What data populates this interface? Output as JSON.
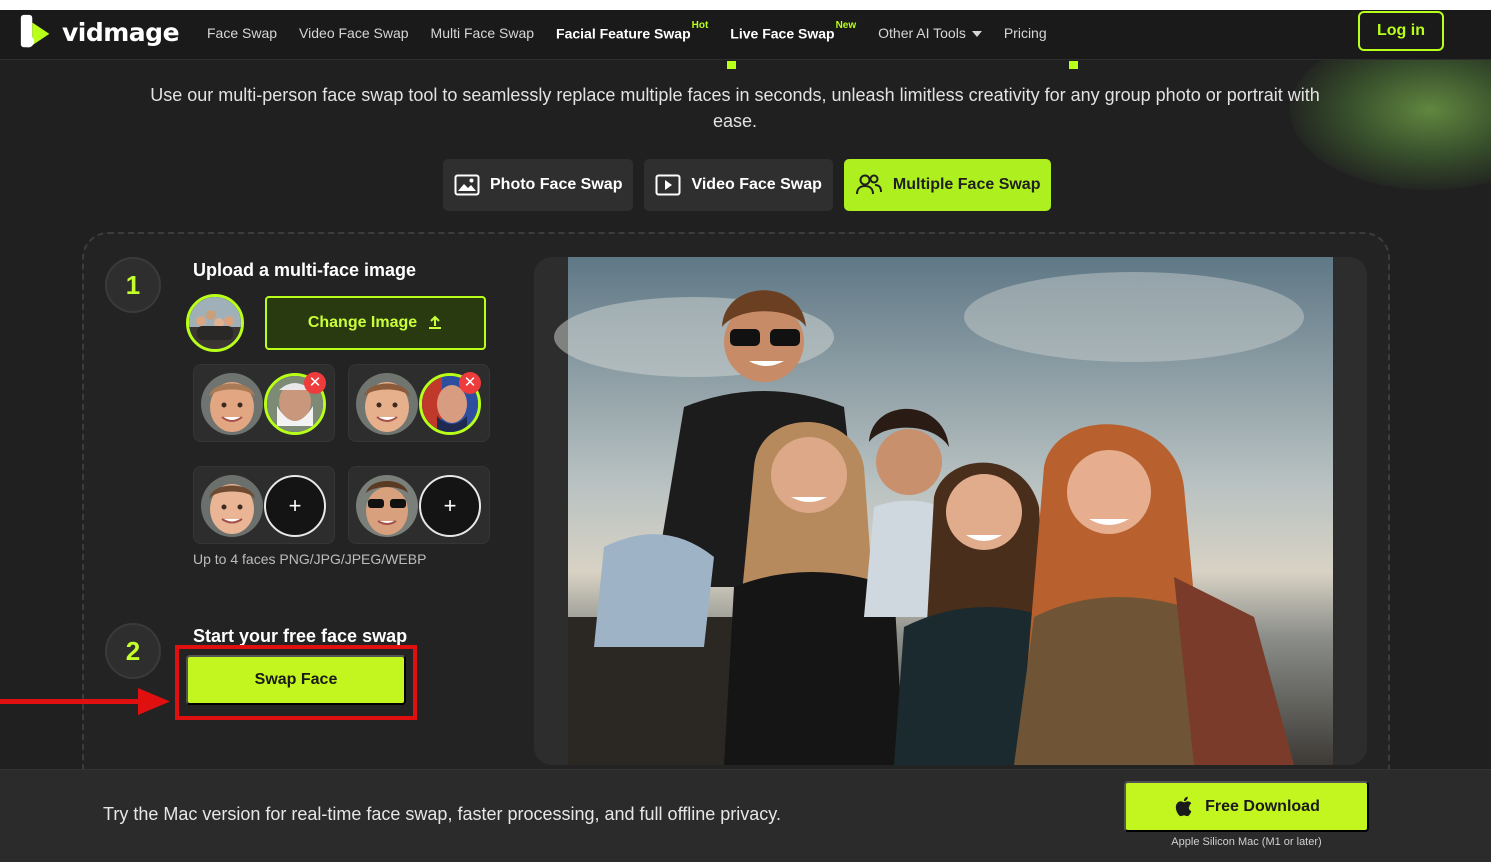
{
  "brand": {
    "name": "vidmage"
  },
  "nav": {
    "items": [
      {
        "label": "Face Swap",
        "bold": false
      },
      {
        "label": "Video Face Swap",
        "bold": false
      },
      {
        "label": "Multi Face Swap",
        "bold": false
      },
      {
        "label": "Facial Feature Swap",
        "badge": "Hot",
        "bold": true
      },
      {
        "label": "Live Face Swap",
        "badge": "New",
        "bold": true
      },
      {
        "label": "Other AI Tools",
        "dropdown": true,
        "bold": false
      },
      {
        "label": "Pricing",
        "bold": false
      }
    ],
    "login_label": "Log in"
  },
  "hero": {
    "subtitle": "Use our multi-person face swap tool to seamlessly replace multiple faces in seconds, unleash limitless creativity for any group photo or portrait with ease."
  },
  "tabs": [
    {
      "label": "Photo Face Swap",
      "icon": "image-icon",
      "active": false
    },
    {
      "label": "Video Face Swap",
      "icon": "play-icon",
      "active": false
    },
    {
      "label": "Multiple Face Swap",
      "icon": "users-icon",
      "active": true
    }
  ],
  "step1": {
    "number": "1",
    "title": "Upload a multi-face image",
    "change_label": "Change Image",
    "hint": "Up to 4 faces PNG/JPG/JPEG/WEBP",
    "remove_symbol": "✕",
    "add_symbol": "+"
  },
  "step2": {
    "number": "2",
    "title": "Start your free face swap",
    "button_label": "Swap Face"
  },
  "banner": {
    "text": "Try the Mac version for real-time face swap, faster processing, and full offline privacy.",
    "download_label": "Free Download",
    "download_note": "Apple Silicon Mac (M1 or later)"
  },
  "colors": {
    "accent": "#b8ff1a",
    "background": "#202020",
    "highlight_red": "#e01010"
  }
}
